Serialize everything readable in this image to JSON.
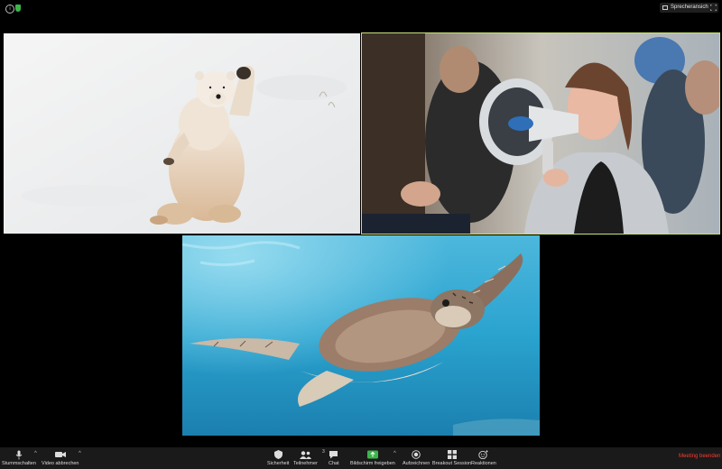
{
  "topbar": {
    "speaker_view_label": "Sprecheransicht",
    "info_icon": "i"
  },
  "tiles": [
    {
      "id": "tile-bear",
      "content": "polar-bear-video"
    },
    {
      "id": "tile-speaker",
      "content": "speaker-megaphone-video",
      "active_speaker": true
    },
    {
      "id": "tile-turtle",
      "content": "sea-turtle-video"
    }
  ],
  "toolbar": {
    "mute_label": "Stummschalten",
    "video_label": "Video abbrechen",
    "security_label": "Sicherheit",
    "participants_label": "Teilnehmer",
    "participants_count": "3",
    "chat_label": "Chat",
    "share_label": "Bildschirm freigeben",
    "record_label": "Aufzeichnen",
    "breakout_label": "Breakout Session",
    "reactions_label": "Reaktionen",
    "end_label": "Meeting beenden"
  },
  "colors": {
    "active_border": "#c8e27a",
    "share_green": "#3bb54a",
    "end_red": "#ff3b30"
  }
}
